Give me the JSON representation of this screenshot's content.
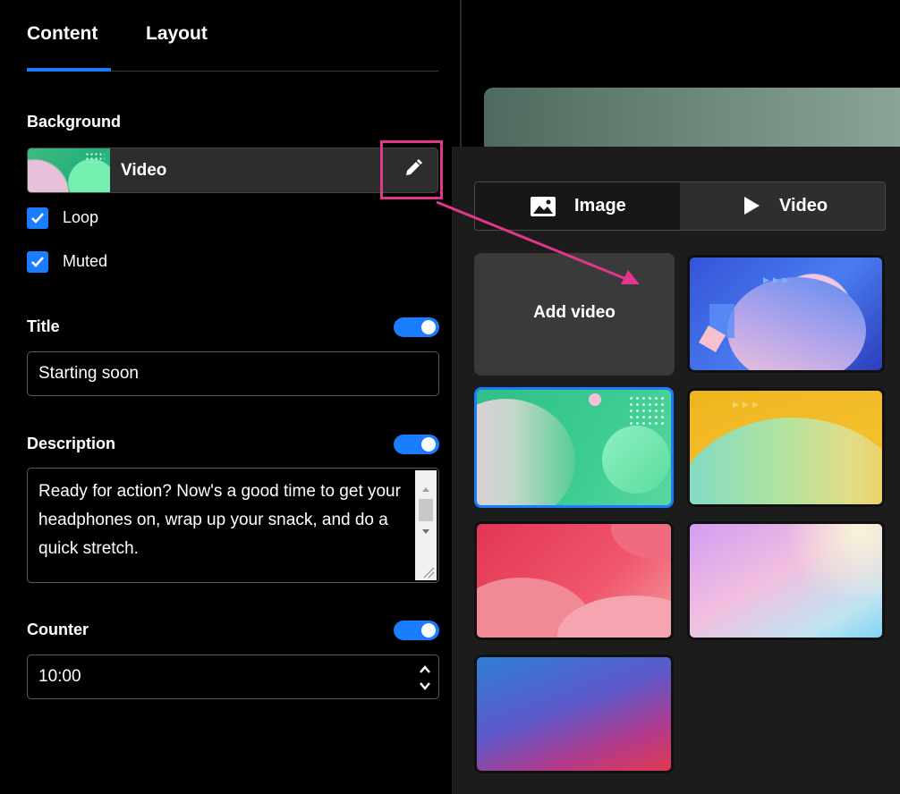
{
  "tabs": [
    {
      "label": "Content",
      "active": true
    },
    {
      "label": "Layout",
      "active": false
    }
  ],
  "background": {
    "heading": "Background",
    "type_label": "Video",
    "options": [
      {
        "label": "Loop",
        "checked": true
      },
      {
        "label": "Muted",
        "checked": true
      }
    ]
  },
  "title": {
    "heading": "Title",
    "enabled": true,
    "value": "Starting soon"
  },
  "description": {
    "heading": "Description",
    "enabled": true,
    "value": "Ready for action? Now's a good time to get your headphones on, wrap up your snack, and do a quick stretch."
  },
  "counter": {
    "heading": "Counter",
    "enabled": true,
    "value": "10:00"
  },
  "picker": {
    "segments": [
      {
        "label": "Image",
        "icon": "image-icon",
        "active": false
      },
      {
        "label": "Video",
        "icon": "play-icon",
        "active": true
      }
    ],
    "add_label": "Add video",
    "selected_index": 1,
    "thumbnails": [
      "blue-circles",
      "green-circles",
      "yellow-waves",
      "red-waves",
      "pastel-gradient",
      "blue-red-gradient"
    ]
  },
  "colors": {
    "accent": "#1a7cff",
    "highlight": "#e2358c",
    "panel": "#1c1c1c"
  }
}
